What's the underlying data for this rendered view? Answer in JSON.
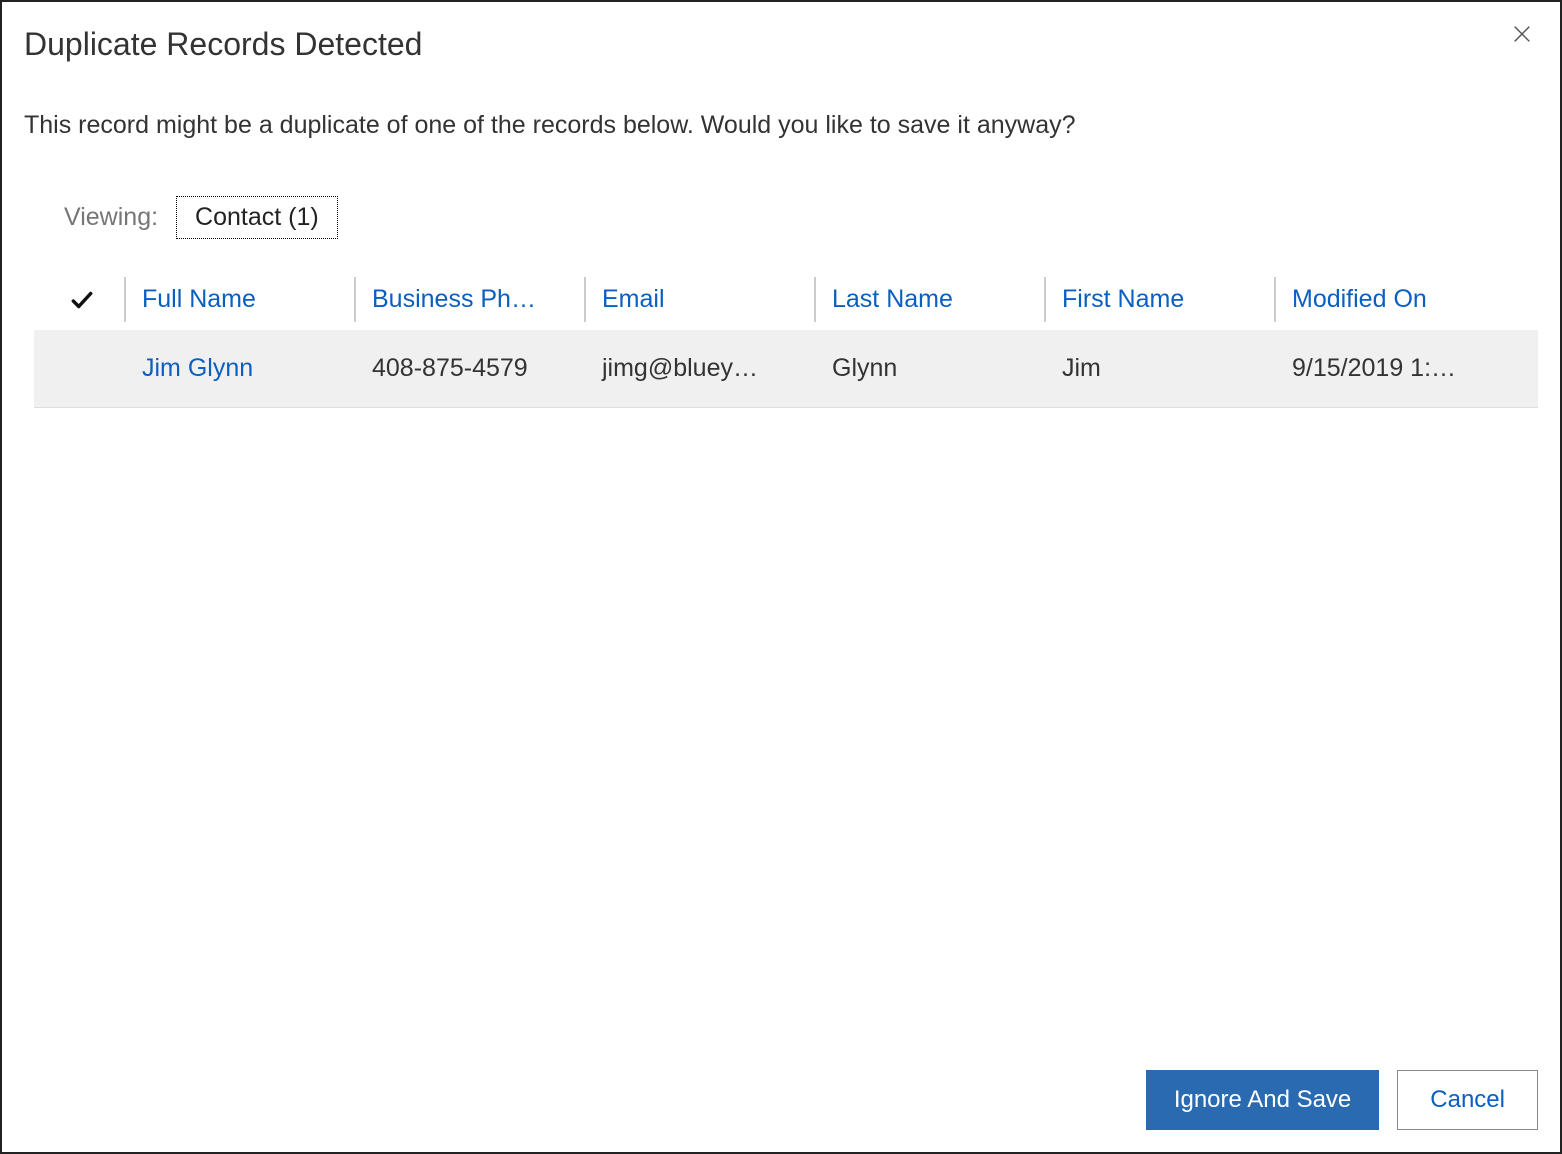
{
  "dialog": {
    "title": "Duplicate Records Detected",
    "message": "This record might be a duplicate of one of the records below. Would you like to save it anyway?"
  },
  "viewing": {
    "label": "Viewing:",
    "tab": "Contact (1)"
  },
  "table": {
    "columns": {
      "full_name": "Full Name",
      "business_phone": "Business Ph…",
      "email": "Email",
      "last_name": "Last Name",
      "first_name": "First Name",
      "modified_on": "Modified On"
    },
    "rows": [
      {
        "full_name": "Jim Glynn",
        "business_phone": "408-875-4579",
        "email": "jimg@bluey…",
        "last_name": "Glynn",
        "first_name": "Jim",
        "modified_on": "9/15/2019 1:…"
      }
    ]
  },
  "footer": {
    "primary": "Ignore And Save",
    "secondary": "Cancel"
  }
}
